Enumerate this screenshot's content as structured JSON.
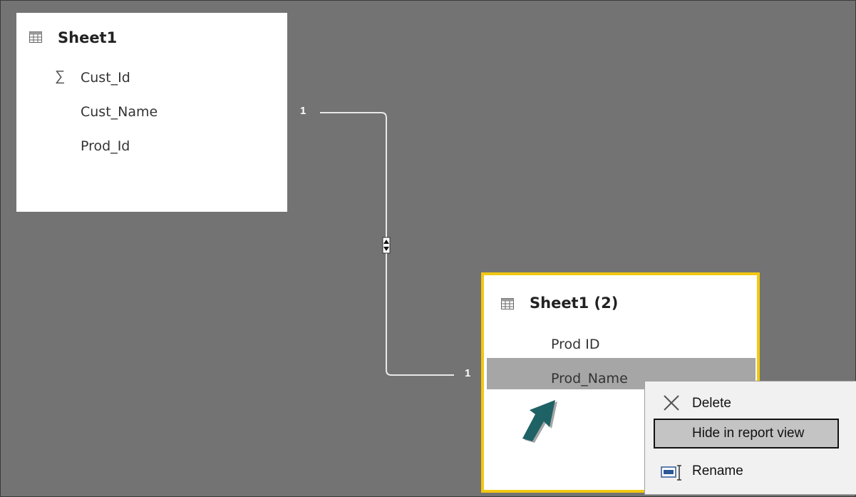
{
  "tables": [
    {
      "title": "Sheet1",
      "fields": [
        "Cust_Id",
        "Cust_Name",
        "Prod_Id"
      ],
      "field_icons": [
        "sigma-icon",
        "",
        ""
      ]
    },
    {
      "title": "Sheet1 (2)",
      "fields": [
        "Prod ID",
        "Prod_Name"
      ],
      "highlighted_field": "Prod_Name",
      "selected": true
    }
  ],
  "relationship": {
    "from_cardinality": "1",
    "to_cardinality": "1"
  },
  "context_menu": {
    "items": [
      {
        "label": "Delete",
        "icon": "close-icon"
      },
      {
        "label": "Hide in report view",
        "icon": ""
      },
      {
        "label": "Rename",
        "icon": "rename-icon"
      }
    ]
  },
  "colors": {
    "canvas": "#737373",
    "selection_border": "#f2c811",
    "arrow": "#1f6266"
  }
}
